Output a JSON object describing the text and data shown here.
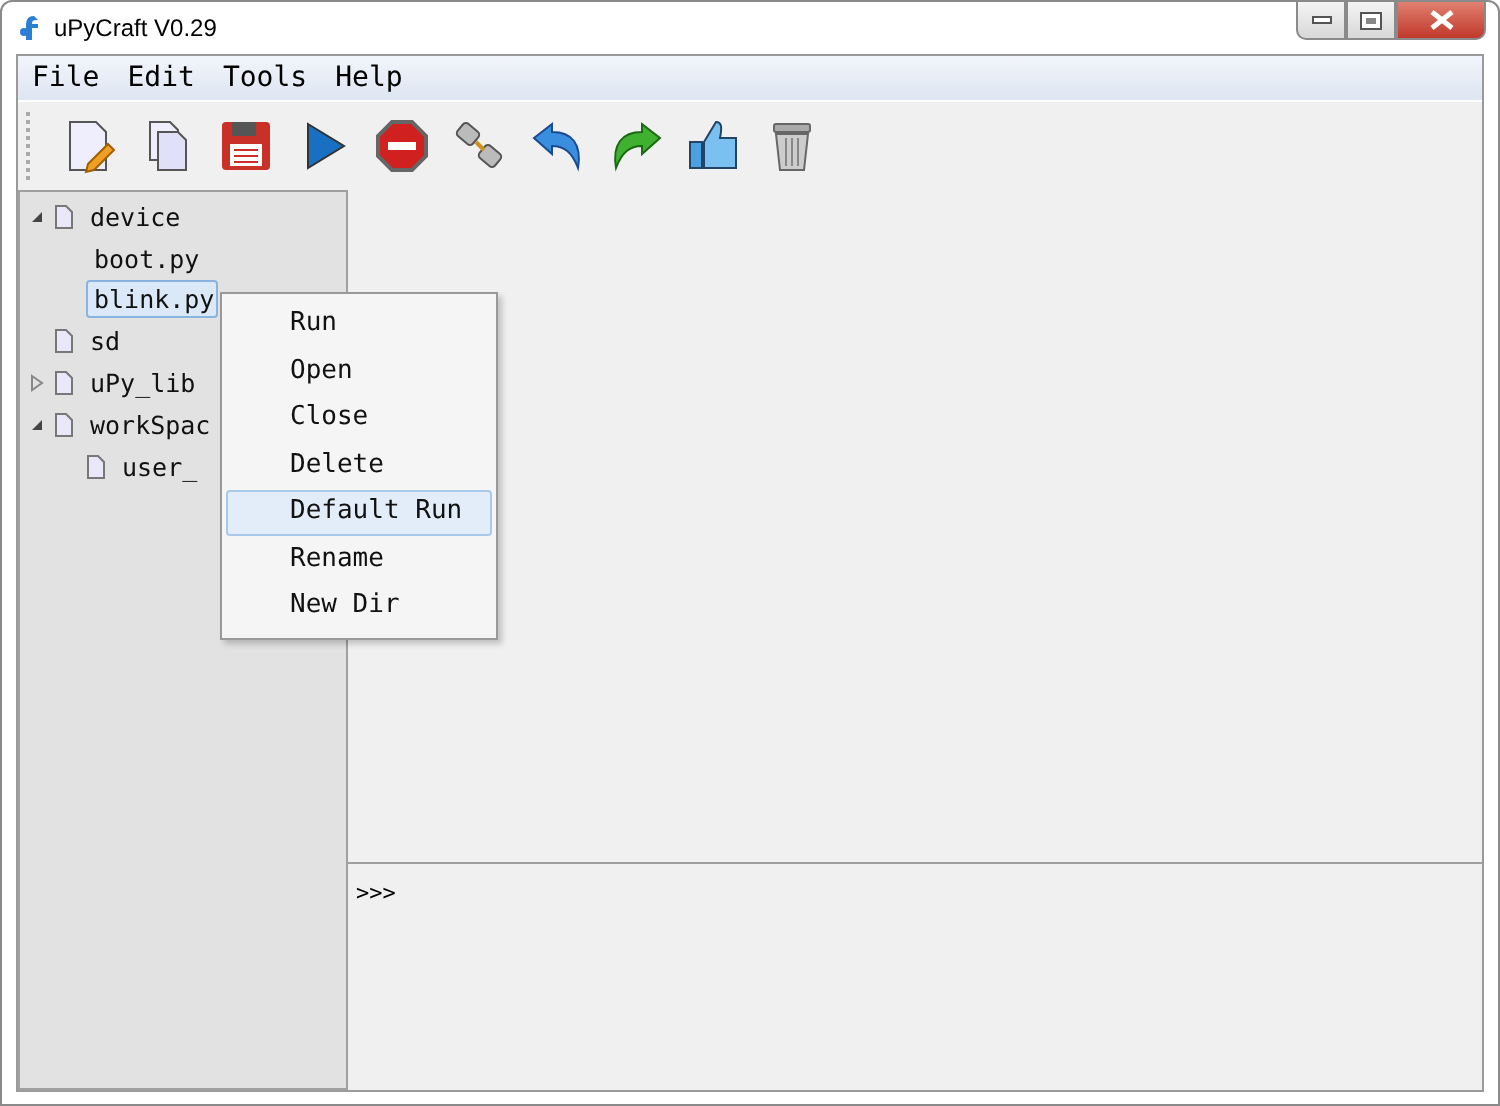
{
  "window": {
    "title": "uPyCraft V0.29"
  },
  "menu_bar": [
    "File",
    "Edit",
    "Tools",
    "Help"
  ],
  "tree": [
    {
      "label": "device",
      "kind": "folder",
      "expanded": true,
      "selected": false,
      "children": [
        {
          "label": "boot.py",
          "kind": "file",
          "selected": false
        },
        {
          "label": "blink.py",
          "kind": "file",
          "selected": true
        }
      ]
    },
    {
      "label": "sd",
      "kind": "folder",
      "selected": false
    },
    {
      "label": "uPy_lib",
      "kind": "folder",
      "expanded": false,
      "selected": false
    },
    {
      "label": "workSpac",
      "kind": "folder",
      "expanded": true,
      "selected": false,
      "children": [
        {
          "label": "user_",
          "kind": "folder",
          "selected": false
        }
      ]
    }
  ],
  "context_menu": [
    {
      "label": "Run",
      "selected": false
    },
    {
      "label": "Open",
      "selected": false
    },
    {
      "label": "Close",
      "selected": false
    },
    {
      "label": "Delete",
      "selected": false
    },
    {
      "label": "Default Run",
      "selected": true
    },
    {
      "label": "Rename",
      "selected": false
    },
    {
      "label": "New Dir",
      "selected": false
    }
  ],
  "terminal": {
    "prompt": ">>>"
  }
}
